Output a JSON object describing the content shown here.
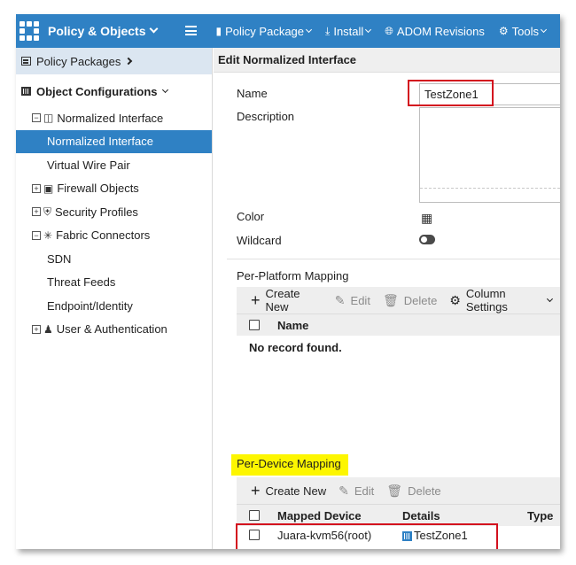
{
  "topbar": {
    "title": "Policy & Objects",
    "menu": [
      {
        "label": "Policy Package",
        "icon": "package-icon"
      },
      {
        "label": "Install",
        "icon": "install-icon"
      },
      {
        "label": "ADOM Revisions",
        "icon": "globe-icon"
      },
      {
        "label": "Tools",
        "icon": "gear-icon"
      }
    ],
    "accent_color": "#2f81c4"
  },
  "sidebar": {
    "policy_packages": "Policy Packages",
    "object_configurations": "Object Configurations",
    "items": [
      {
        "label": "Normalized Interface"
      },
      {
        "label": "Normalized Interface"
      },
      {
        "label": "Virtual Wire Pair"
      },
      {
        "label": "Firewall Objects"
      },
      {
        "label": "Security Profiles"
      },
      {
        "label": "Fabric Connectors"
      },
      {
        "label": "SDN"
      },
      {
        "label": "Threat Feeds"
      },
      {
        "label": "Endpoint/Identity"
      },
      {
        "label": "User & Authentication"
      }
    ]
  },
  "main": {
    "header": "Edit Normalized Interface",
    "form": {
      "name_label": "Name",
      "name_value": "TestZone1",
      "description_label": "Description",
      "description_value": "",
      "color_label": "Color",
      "wildcard_label": "Wildcard",
      "wildcard_on": false
    },
    "per_platform": {
      "title": "Per-Platform Mapping",
      "toolbar": {
        "create": "Create New",
        "edit": "Edit",
        "delete": "Delete",
        "columns": "Column Settings"
      },
      "columns": [
        "Name"
      ],
      "empty_text": "No record found."
    },
    "per_device": {
      "title": "Per-Device Mapping",
      "toolbar": {
        "create": "Create New",
        "edit": "Edit",
        "delete": "Delete"
      },
      "columns": [
        "Mapped Device",
        "Details",
        "Type"
      ],
      "rows": [
        {
          "device": "Juara-kvm56(root)",
          "details": "TestZone1",
          "type": ""
        }
      ]
    }
  },
  "colors": {
    "highlight": "#fdf600",
    "annotation": "#d3101e"
  }
}
